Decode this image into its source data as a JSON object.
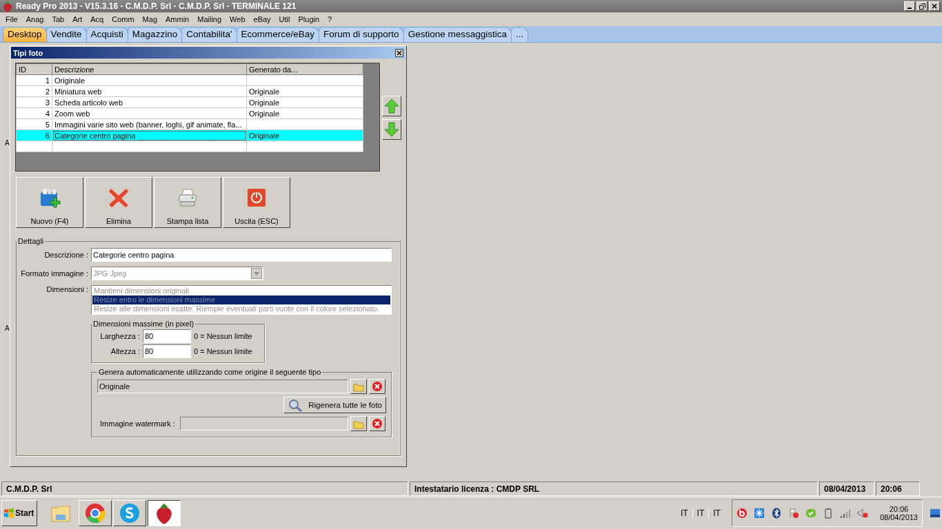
{
  "window": {
    "title": "Ready Pro 2013 - V15.3.16 - C.M.D.P. Srl - C.M.D.P. Srl - TERMINALE 121"
  },
  "menu": [
    "File",
    "Anag",
    "Tab",
    "Art",
    "Acq",
    "Comm",
    "Mag",
    "Ammin",
    "Mailing",
    "Web",
    "eBay",
    "Util",
    "Plugin",
    "?"
  ],
  "tabs": [
    {
      "label": "Desktop",
      "selected": true
    },
    {
      "label": "Vendite",
      "selected": false
    },
    {
      "label": "Acquisti",
      "selected": false
    },
    {
      "label": "Magazzino",
      "selected": false
    },
    {
      "label": "Contabilita'",
      "selected": false
    },
    {
      "label": "Ecommerce/eBay",
      "selected": false
    },
    {
      "label": "Forum di supporto",
      "selected": false
    },
    {
      "label": "Gestione messaggistica",
      "selected": false
    },
    {
      "label": "...",
      "selected": false
    }
  ],
  "background_labels": [
    "A",
    "A"
  ],
  "dialog": {
    "title": "Tipi foto",
    "table": {
      "columns": [
        "ID",
        "Descrizione",
        "Generato da..."
      ],
      "rows": [
        {
          "id": "1",
          "description": "Originale",
          "selected": false
        },
        {
          "id": "2",
          "description": "Miniatura web",
          "generated_from": "Originale",
          "selected": false
        },
        {
          "id": "3",
          "description": "Scheda articolo web",
          "generated_from": "Originale",
          "selected": false
        },
        {
          "id": "4",
          "description": "Zoom web",
          "generated_from": "Originale",
          "selected": false
        },
        {
          "id": "5",
          "description": "Immagini varie sito web (banner, loghi, gif animate, fla...",
          "selected": false
        },
        {
          "id": "6",
          "description": "Categorie centro pagina",
          "generated_from": "Originale",
          "selected": true
        }
      ]
    },
    "buttons": [
      {
        "label": "Nuovo (F4)",
        "kind": "new"
      },
      {
        "label": "Elimina",
        "kind": "delete"
      },
      {
        "label": "Stampa lista",
        "kind": "print"
      },
      {
        "label": "Uscita (ESC)",
        "kind": "exit"
      }
    ],
    "details": {
      "legend": "Dettagli",
      "description_label": "Descrizione :",
      "description_value": "Categorie centro pagina",
      "format_label": "Formato immagine :",
      "format_value": "JPG Jpeg",
      "format_disabled": true,
      "dimensions_label": "Dimensioni :",
      "dimensions_disabled": true,
      "dimension_options": [
        {
          "label": "Mantieni dimensioni originali",
          "selected": false
        },
        {
          "label": "Resize entro le dimensioni massime",
          "selected": true
        },
        {
          "label": "Resize alle dimensioni esatte. Riempie eventuali parti vuote con il colore selezionato.",
          "selected": false
        }
      ],
      "max_size": {
        "legend": "Dimensioni massime (in pixel)",
        "fields": [
          {
            "label": "Larghezza :",
            "value": "80",
            "hint": "0 = Nessun limite"
          },
          {
            "label": "Altezza :",
            "value": "80",
            "hint": "0 = Nessun limite"
          }
        ]
      },
      "generate": {
        "legend": "Genera automaticamente utilizzando come origine il seguente tipo",
        "source_value": "Originale",
        "regen_button": "Rigenera tutte le foto",
        "watermark_label": "Immagine watermark :"
      }
    }
  },
  "status_bar": [
    "C.M.D.P. Srl",
    "Intestatario licenza : CMDP SRL",
    "08/04/2013",
    "20:06"
  ],
  "taskbar": {
    "start": "Start",
    "languages": [
      "IT",
      "IT",
      "IT"
    ],
    "clock_time": "20:06",
    "clock_date": "08/04/2013"
  }
}
